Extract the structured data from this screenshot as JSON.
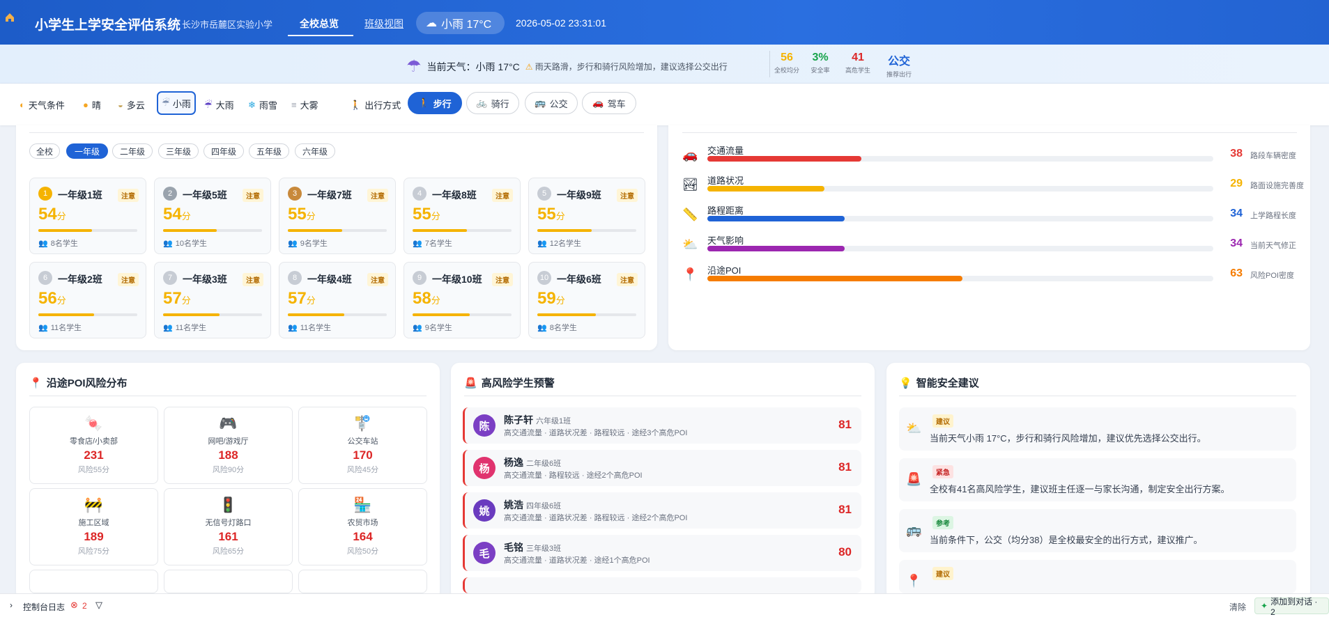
{
  "header": {
    "title": "小学生上学安全评估系统",
    "school": "长沙市岳麓区实验小学",
    "tabs": [
      {
        "label": "全校总览"
      },
      {
        "label": "班级视图"
      }
    ],
    "weather_pill": "小雨 17°C",
    "datetime": "2026-05-02 23:31:01"
  },
  "summary": {
    "weather_label": "当前天气：小雨 17°C",
    "warning": "雨天路滑，步行和骑行风险增加，建议选择公交出行",
    "stats": [
      {
        "value": "56",
        "label": "全校均分",
        "color": "#f5b301"
      },
      {
        "value": "3%",
        "label": "安全率",
        "color": "#16a34a"
      },
      {
        "value": "41",
        "label": "高危学生",
        "color": "#dc2626"
      },
      {
        "value": "公交",
        "label": "推荐出行",
        "color": "#1f63d6"
      }
    ]
  },
  "filters": {
    "weather_label": "天气条件",
    "weather": [
      "晴",
      "多云",
      "小雨",
      "大雨",
      "雨雪",
      "大雾"
    ],
    "mode_label": "出行方式",
    "modes": [
      "步行",
      "骑行",
      "公交",
      "驾车"
    ]
  },
  "grades": [
    "全校",
    "一年级",
    "二年级",
    "三年级",
    "四年级",
    "五年级",
    "六年级"
  ],
  "classes": [
    {
      "rank": "1",
      "name": "一年级1班",
      "badge": "注意",
      "score": "54",
      "unit": "分",
      "students": "8名学生",
      "pct": 54
    },
    {
      "rank": "2",
      "name": "一年级5班",
      "badge": "注意",
      "score": "54",
      "unit": "分",
      "students": "10名学生",
      "pct": 54
    },
    {
      "rank": "3",
      "name": "一年级7班",
      "badge": "注意",
      "score": "55",
      "unit": "分",
      "students": "9名学生",
      "pct": 55
    },
    {
      "rank": "4",
      "name": "一年级8班",
      "badge": "注意",
      "score": "55",
      "unit": "分",
      "students": "7名学生",
      "pct": 55
    },
    {
      "rank": "5",
      "name": "一年级9班",
      "badge": "注意",
      "score": "55",
      "unit": "分",
      "students": "12名学生",
      "pct": 55
    },
    {
      "rank": "6",
      "name": "一年级2班",
      "badge": "注意",
      "score": "56",
      "unit": "分",
      "students": "11名学生",
      "pct": 56
    },
    {
      "rank": "7",
      "name": "一年级3班",
      "badge": "注意",
      "score": "57",
      "unit": "分",
      "students": "11名学生",
      "pct": 57
    },
    {
      "rank": "8",
      "name": "一年级4班",
      "badge": "注意",
      "score": "57",
      "unit": "分",
      "students": "11名学生",
      "pct": 57
    },
    {
      "rank": "9",
      "name": "一年级10班",
      "badge": "注意",
      "score": "58",
      "unit": "分",
      "students": "9名学生",
      "pct": 58
    },
    {
      "rank": "10",
      "name": "一年级6班",
      "badge": "注意",
      "score": "59",
      "unit": "分",
      "students": "8名学生",
      "pct": 59
    }
  ],
  "factors": [
    {
      "name": "交通流量",
      "value": "38",
      "desc": "路段车辆密度",
      "color": "#e53935",
      "pct": 38
    },
    {
      "name": "道路状况",
      "value": "29",
      "desc": "路面设施完善度",
      "color": "#f5b301",
      "pct": 29
    },
    {
      "name": "路程距离",
      "value": "34",
      "desc": "上学路程长度",
      "color": "#1f63d6",
      "pct": 34
    },
    {
      "name": "天气影响",
      "value": "34",
      "desc": "当前天气修正",
      "color": "#9c27b0",
      "pct": 34
    },
    {
      "name": "沿途POI",
      "value": "63",
      "desc": "风险POI密度",
      "color": "#f57c00",
      "pct": 63
    }
  ],
  "poi": {
    "title": "沿途POI风险分布",
    "items": [
      {
        "name": "零食店/小卖部",
        "count": "231",
        "risk": "风险55分"
      },
      {
        "name": "网吧/游戏厅",
        "count": "188",
        "risk": "风险90分"
      },
      {
        "name": "公交车站",
        "count": "170",
        "risk": "风险45分"
      },
      {
        "name": "施工区域",
        "count": "189",
        "risk": "风险75分"
      },
      {
        "name": "无信号灯路口",
        "count": "161",
        "risk": "风险65分"
      },
      {
        "name": "农贸市场",
        "count": "164",
        "risk": "风险50分"
      }
    ]
  },
  "alerts": {
    "title": "高风险学生预警",
    "items": [
      {
        "avatar": "陈",
        "name": "陈子轩",
        "cls": "六年级1班",
        "desc": "高交通流量 · 道路状况差 · 路程较远 · 途经3个高危POI",
        "score": "81",
        "color": "#7b3fc4"
      },
      {
        "avatar": "杨",
        "name": "杨逸",
        "cls": "二年级6班",
        "desc": "高交通流量 · 路程较远 · 途经2个高危POI",
        "score": "81",
        "color": "#e0336e"
      },
      {
        "avatar": "姚",
        "name": "姚浩",
        "cls": "四年级6班",
        "desc": "高交通流量 · 道路状况差 · 路程较远 · 途经2个高危POI",
        "score": "81",
        "color": "#6a3bbf"
      },
      {
        "avatar": "毛",
        "name": "毛铭",
        "cls": "三年级3班",
        "desc": "高交通流量 · 道路状况差 · 途经1个高危POI",
        "score": "80",
        "color": "#7b3fc4"
      }
    ]
  },
  "tips": {
    "title": "智能安全建议",
    "items": [
      {
        "badge": "建议",
        "text": "当前天气小雨 17°C，步行和骑行风险增加，建议优先选择公交出行。",
        "badge_bg": "#fff3cd",
        "badge_fg": "#b26a00"
      },
      {
        "badge": "紧急",
        "text": "全校有41名高风险学生，建议班主任逐一与家长沟通，制定安全出行方案。",
        "badge_bg": "#fde2e2",
        "badge_fg": "#c62828"
      },
      {
        "badge": "参考",
        "text": "当前条件下，公交（均分38）是全校最安全的出行方式，建议推广。",
        "badge_bg": "#dcf5e3",
        "badge_fg": "#1b8a3f"
      },
      {
        "badge": "建议",
        "text": "",
        "badge_bg": "#fff3cd",
        "badge_fg": "#b26a00"
      }
    ]
  },
  "footer": {
    "console": "控制台日志",
    "errors": "2",
    "clear": "清除",
    "add": "添加到对话 · 2"
  }
}
